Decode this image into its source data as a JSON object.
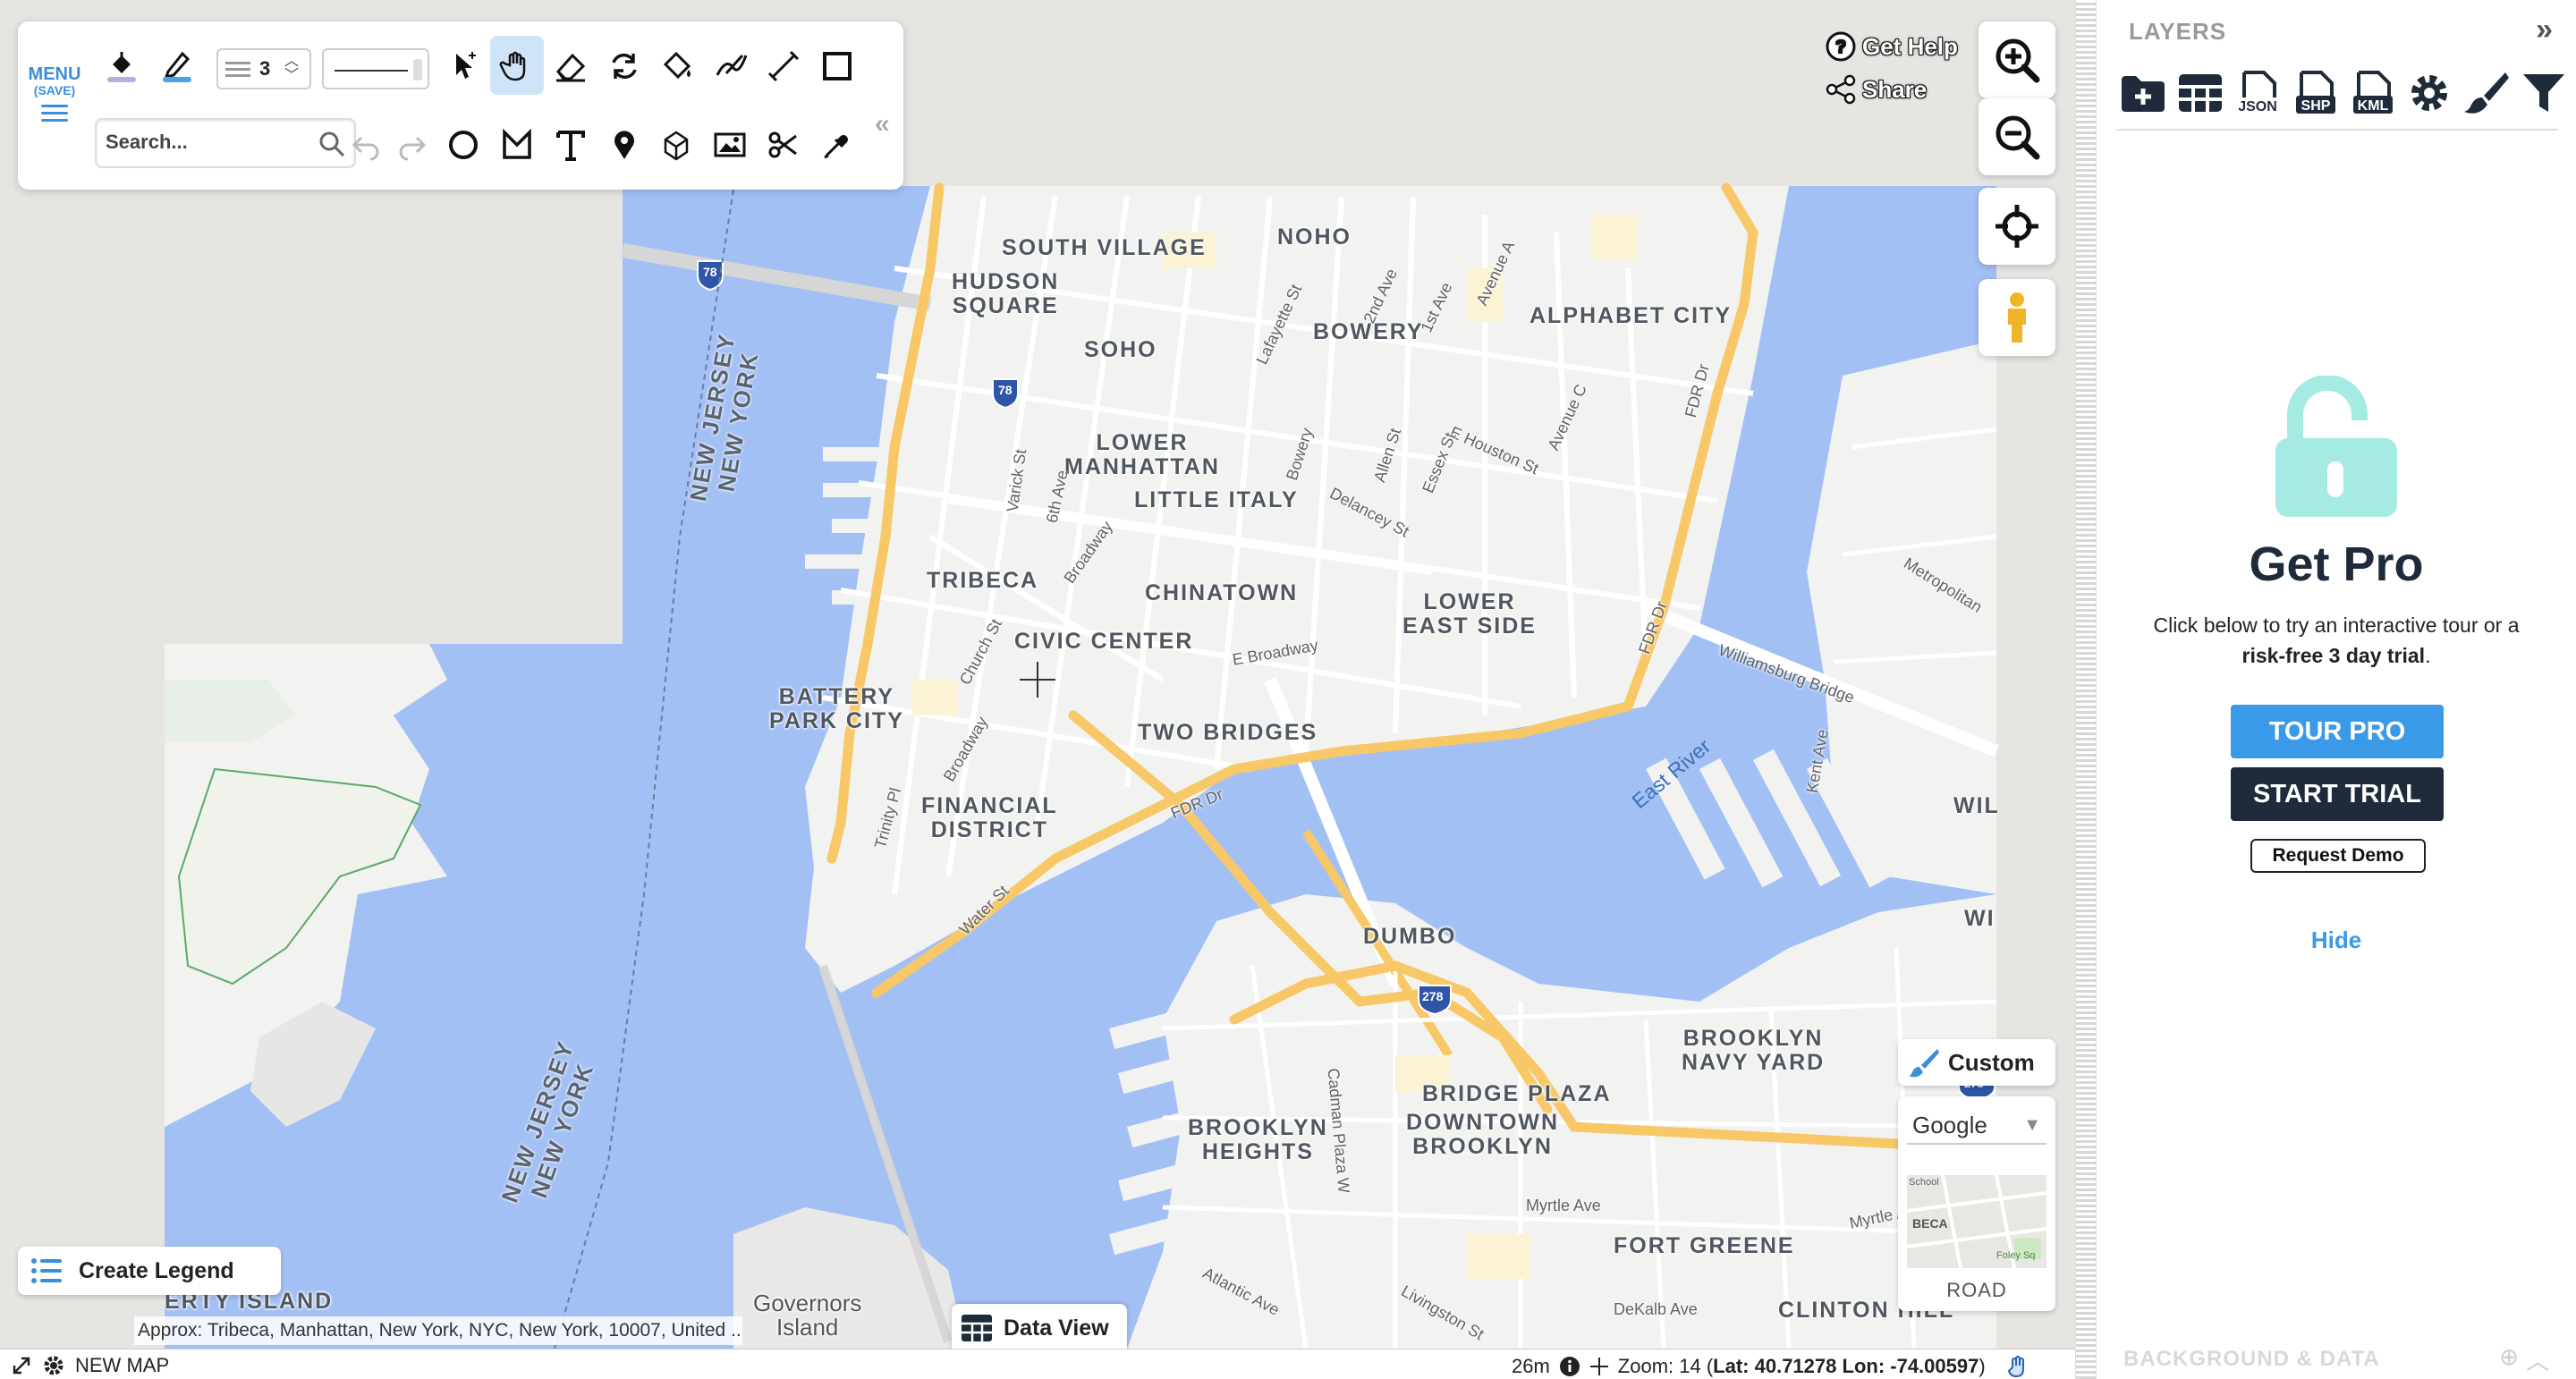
{
  "toolbar": {
    "menu_label": "MENU",
    "menu_sub": "(SAVE)",
    "stroke_width": "3",
    "search_placeholder": "Search..."
  },
  "map": {
    "neighborhoods": [
      {
        "id": "south-village",
        "text": "SOUTH VILLAGE"
      },
      {
        "id": "noho",
        "text": "NOHO"
      },
      {
        "id": "hudson-square",
        "text": "HUDSON\nSQUARE"
      },
      {
        "id": "soho",
        "text": "SOHO"
      },
      {
        "id": "bowery",
        "text": "BOWERY"
      },
      {
        "id": "alphabet-city",
        "text": "ALPHABET CITY"
      },
      {
        "id": "lower-manhattan",
        "text": "LOWER\nMANHATTAN"
      },
      {
        "id": "little-italy",
        "text": "LITTLE ITALY"
      },
      {
        "id": "tribeca",
        "text": "TRIBECA"
      },
      {
        "id": "chinatown",
        "text": "CHINATOWN"
      },
      {
        "id": "lower-east-side",
        "text": "LOWER\nEAST SIDE"
      },
      {
        "id": "civic-center",
        "text": "CIVIC CENTER"
      },
      {
        "id": "battery-park-city",
        "text": "BATTERY\nPARK CITY"
      },
      {
        "id": "two-bridges",
        "text": "TWO BRIDGES"
      },
      {
        "id": "financial-district",
        "text": "FINANCIAL\nDISTRICT"
      },
      {
        "id": "dumbo",
        "text": "DUMBO"
      },
      {
        "id": "brooklyn-navy-yard",
        "text": "BROOKLYN\nNAVY YARD"
      },
      {
        "id": "bridge-plaza",
        "text": "BRIDGE PLAZA"
      },
      {
        "id": "downtown-brooklyn",
        "text": "DOWNTOWN\nBROOKLYN"
      },
      {
        "id": "brooklyn-heights",
        "text": "BROOKLYN\nHEIGHTS"
      },
      {
        "id": "fort-greene",
        "text": "FORT GREENE"
      },
      {
        "id": "clinton-hill",
        "text": "CLINTON HILL"
      },
      {
        "id": "ellis-island",
        "text": "ERTY ISLAND"
      },
      {
        "id": "wi-1",
        "text": "WIL"
      },
      {
        "id": "wi-2",
        "text": "WI"
      }
    ],
    "streets": [
      {
        "id": "lafayette",
        "text": "Lafayette St"
      },
      {
        "id": "2nd-ave",
        "text": "2nd Ave"
      },
      {
        "id": "1st-ave",
        "text": "1st Ave"
      },
      {
        "id": "avenue-a",
        "text": "Avenue A"
      },
      {
        "id": "avenue-c",
        "text": "Avenue C"
      },
      {
        "id": "e-houston",
        "text": "E Houston St"
      },
      {
        "id": "varick",
        "text": "Varick St"
      },
      {
        "id": "6th-ave",
        "text": "6th Ave"
      },
      {
        "id": "bowery-st",
        "text": "Bowery"
      },
      {
        "id": "allen",
        "text": "Allen St"
      },
      {
        "id": "essex",
        "text": "Essex St"
      },
      {
        "id": "delancey",
        "text": "Delancey St"
      },
      {
        "id": "broadway-1",
        "text": "Broadway"
      },
      {
        "id": "church",
        "text": "Church St"
      },
      {
        "id": "e-broadway",
        "text": "E Broadway"
      },
      {
        "id": "broadway-2",
        "text": "Broadway"
      },
      {
        "id": "trinity",
        "text": "Trinity Pl"
      },
      {
        "id": "water",
        "text": "Water St"
      },
      {
        "id": "fdr-1",
        "text": "FDR Dr"
      },
      {
        "id": "fdr-2",
        "text": "FDR Dr"
      },
      {
        "id": "fdr-3",
        "text": "FDR Dr"
      },
      {
        "id": "williamsburg",
        "text": "Williamsburg Bridge"
      },
      {
        "id": "metropolitan",
        "text": "Metropolitan"
      },
      {
        "id": "kent",
        "text": "Kent Ave"
      },
      {
        "id": "cadman",
        "text": "Cadman Plaza W"
      },
      {
        "id": "myrtle-1",
        "text": "Myrtle Ave"
      },
      {
        "id": "myrtle-2",
        "text": "Myrtle Ave"
      },
      {
        "id": "atlantic",
        "text": "Atlantic Ave"
      },
      {
        "id": "livingston",
        "text": "Livingston St"
      },
      {
        "id": "dekalb",
        "text": "DeKalb Ave"
      }
    ],
    "water_labels": [
      {
        "id": "east-river",
        "text": "East River"
      }
    ],
    "state_labels": [
      {
        "id": "nj-ny-top",
        "text": "NEW JERSEY\nNEW YORK"
      },
      {
        "id": "nj-ny-bottom",
        "text": "NEW JERSEY\nNEW YORK"
      }
    ],
    "shields": [
      {
        "id": "i78-top",
        "text": "78"
      },
      {
        "id": "i78-mid",
        "text": "78"
      },
      {
        "id": "i278",
        "text": "278"
      },
      {
        "id": "i278-edge",
        "text": "278"
      }
    ],
    "places": [
      {
        "id": "governors-island",
        "text": "Governors\nIsland"
      }
    ],
    "colors": {
      "water": "#a3c0f5",
      "land": "#f2f2f0",
      "highway": "#f8c868",
      "road": "#ffffff",
      "park": "#fbf3d4"
    }
  },
  "controls": {
    "get_help": "Get Help",
    "share": "Share",
    "custom_label": "Custom",
    "basemap_select": "Google",
    "basemap_mode": "ROAD",
    "thumb_text": "BECA",
    "thumb_text2": "Foley Sq",
    "thumb_text3": "School",
    "create_legend": "Create Legend",
    "data_view": "Data View",
    "approx_address": "Approx: Tribeca, Manhattan, New York, NYC, New York, 10007, United ..."
  },
  "statusbar": {
    "map_name": "NEW MAP",
    "scale": "26m",
    "zoom_text": "Zoom: 14 (",
    "lat_label": "Lat: 40.71278",
    "lon_label": "Lon: -74.00597",
    "close_paren": ")"
  },
  "panel": {
    "title": "LAYERS",
    "tool_icons": [
      "add-layer-icon",
      "table-icon",
      "json-icon",
      "shp-icon",
      "kml-icon",
      "settings-icon",
      "style-brush-icon",
      "filter-icon"
    ],
    "json_text": "JSON",
    "shp_text": "SHP",
    "kml_text": "KML",
    "pro_title": "Get Pro",
    "pro_desc_1": "Click below to try an interactive tour or a ",
    "pro_desc_bold": "risk-free 3 day trial",
    "pro_desc_2": ".",
    "tour_button": "TOUR PRO",
    "trial_button": "START TRIAL",
    "demo_button": "Request Demo",
    "hide_link": "Hide",
    "background_data": "BACKGROUND & DATA"
  }
}
